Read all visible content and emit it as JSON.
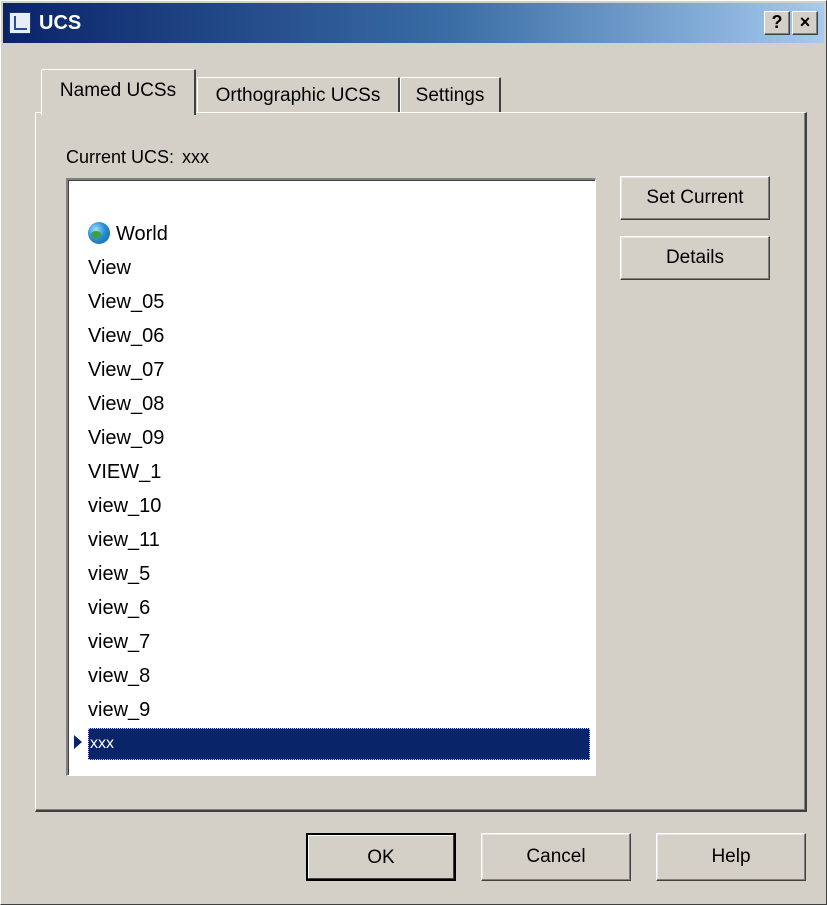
{
  "window": {
    "title": "UCS",
    "help_button": "?",
    "close_button": "×"
  },
  "tabs": [
    {
      "label": "Named UCSs",
      "active": true
    },
    {
      "label": "Orthographic UCSs",
      "active": false
    },
    {
      "label": "Settings",
      "active": false
    }
  ],
  "named_ucs": {
    "current_label": "Current UCS:",
    "current_value": "xxx",
    "items": [
      {
        "label": "World",
        "icon": "globe-icon"
      },
      {
        "label": "View"
      },
      {
        "label": "View_05"
      },
      {
        "label": "View_06"
      },
      {
        "label": "View_07"
      },
      {
        "label": "View_08"
      },
      {
        "label": "View_09"
      },
      {
        "label": "VIEW_1"
      },
      {
        "label": "view_10"
      },
      {
        "label": "view_11"
      },
      {
        "label": "view_5"
      },
      {
        "label": "view_6"
      },
      {
        "label": "view_7"
      },
      {
        "label": "view_8"
      },
      {
        "label": "view_9"
      },
      {
        "label": "xxx",
        "selected": true
      }
    ],
    "set_current_label": "Set Current",
    "details_label": "Details"
  },
  "footer": {
    "ok_label": "OK",
    "cancel_label": "Cancel",
    "help_label": "Help"
  },
  "colors": {
    "face": "#d4d0c8",
    "title_start": "#0a246a",
    "title_end": "#a6caf0",
    "selection": "#0a246a"
  }
}
